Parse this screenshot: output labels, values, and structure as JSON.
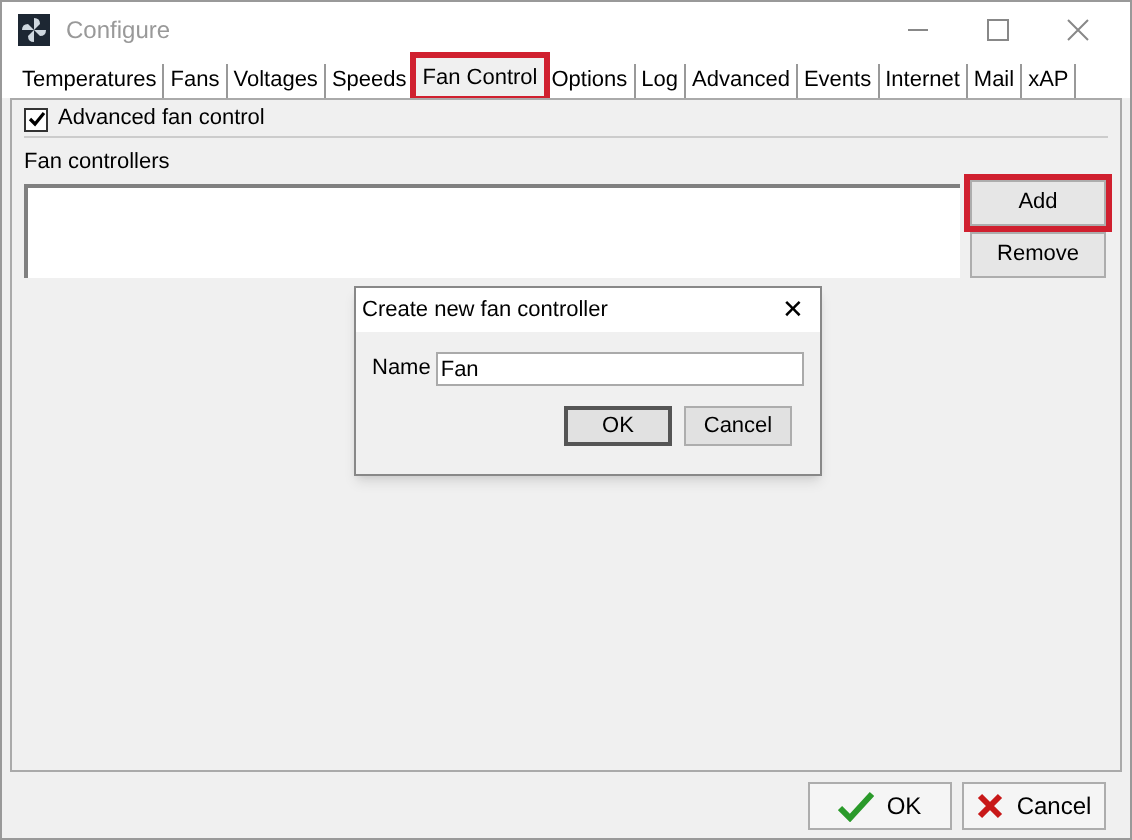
{
  "window": {
    "title": "Configure"
  },
  "tabs": [
    {
      "label": "Temperatures",
      "selected": false,
      "highlighted": false
    },
    {
      "label": "Fans",
      "selected": false,
      "highlighted": false
    },
    {
      "label": "Voltages",
      "selected": false,
      "highlighted": false
    },
    {
      "label": "Speeds",
      "selected": false,
      "highlighted": false
    },
    {
      "label": "Fan Control",
      "selected": true,
      "highlighted": true
    },
    {
      "label": "Options",
      "selected": false,
      "highlighted": false
    },
    {
      "label": "Log",
      "selected": false,
      "highlighted": false
    },
    {
      "label": "Advanced",
      "selected": false,
      "highlighted": false
    },
    {
      "label": "Events",
      "selected": false,
      "highlighted": false
    },
    {
      "label": "Internet",
      "selected": false,
      "highlighted": false
    },
    {
      "label": "Mail",
      "selected": false,
      "highlighted": false
    },
    {
      "label": "xAP",
      "selected": false,
      "highlighted": false
    }
  ],
  "advanced_fan_control": {
    "label": "Advanced fan control",
    "checked": true
  },
  "fan_controllers": {
    "label": "Fan controllers",
    "buttons": [
      {
        "label": "Add",
        "highlighted": true
      },
      {
        "label": "Remove",
        "highlighted": false
      }
    ]
  },
  "dialog": {
    "title": "Create new fan controller",
    "close": "✕",
    "name_label": "Name",
    "name_value": "Fan",
    "buttons": [
      {
        "label": "OK",
        "default": true
      },
      {
        "label": "Cancel",
        "default": false
      }
    ]
  },
  "footer_buttons": [
    {
      "label": "OK",
      "kind": "ok"
    },
    {
      "label": "Cancel",
      "kind": "cancel"
    }
  ]
}
